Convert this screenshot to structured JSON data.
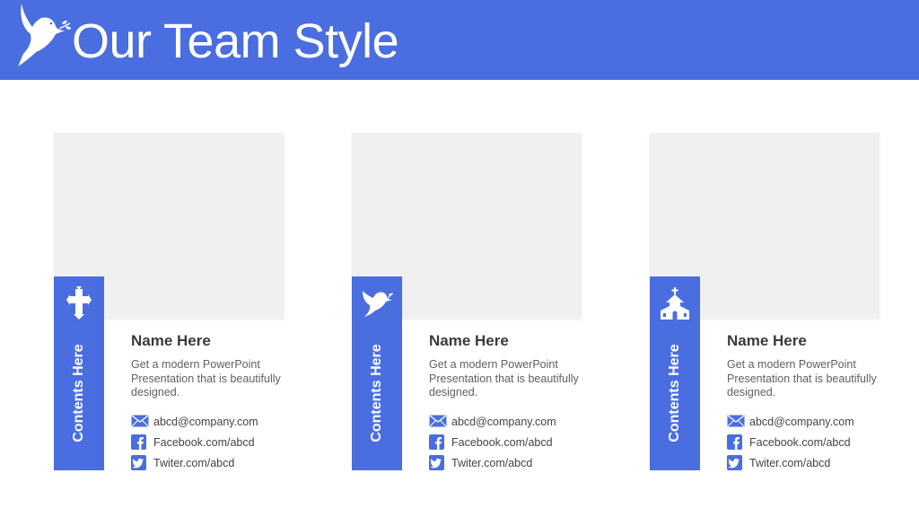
{
  "header": {
    "title": "Our Team Style",
    "logo_icon": "dove-with-olive-branch-icon",
    "background": "#4a6ee0"
  },
  "cards": [
    {
      "icon": "cross-icon",
      "side_label": "Contents Here",
      "name": "Name Here",
      "description": "Get a modern PowerPoint Presentation that is beautifully designed.",
      "email": "abcd@company.com",
      "facebook": "Facebook.com/abcd",
      "twitter": "Twiter.com/abcd"
    },
    {
      "icon": "dove-icon",
      "side_label": "Contents Here",
      "name": "Name Here",
      "description": "Get a modern PowerPoint Presentation that is beautifully designed.",
      "email": "abcd@company.com",
      "facebook": "Facebook.com/abcd",
      "twitter": "Twiter.com/abcd"
    },
    {
      "icon": "church-icon",
      "side_label": "Contents Here",
      "name": "Name Here",
      "description": "Get a modern PowerPoint Presentation that is beautifully designed.",
      "email": "abcd@company.com",
      "facebook": "Facebook.com/abcd",
      "twitter": "Twiter.com/abcd"
    }
  ],
  "colors": {
    "accent": "#4a6ee0",
    "photo_placeholder": "#f0f0f0",
    "text_dark": "#3a3a3a",
    "text_muted": "#606060"
  }
}
